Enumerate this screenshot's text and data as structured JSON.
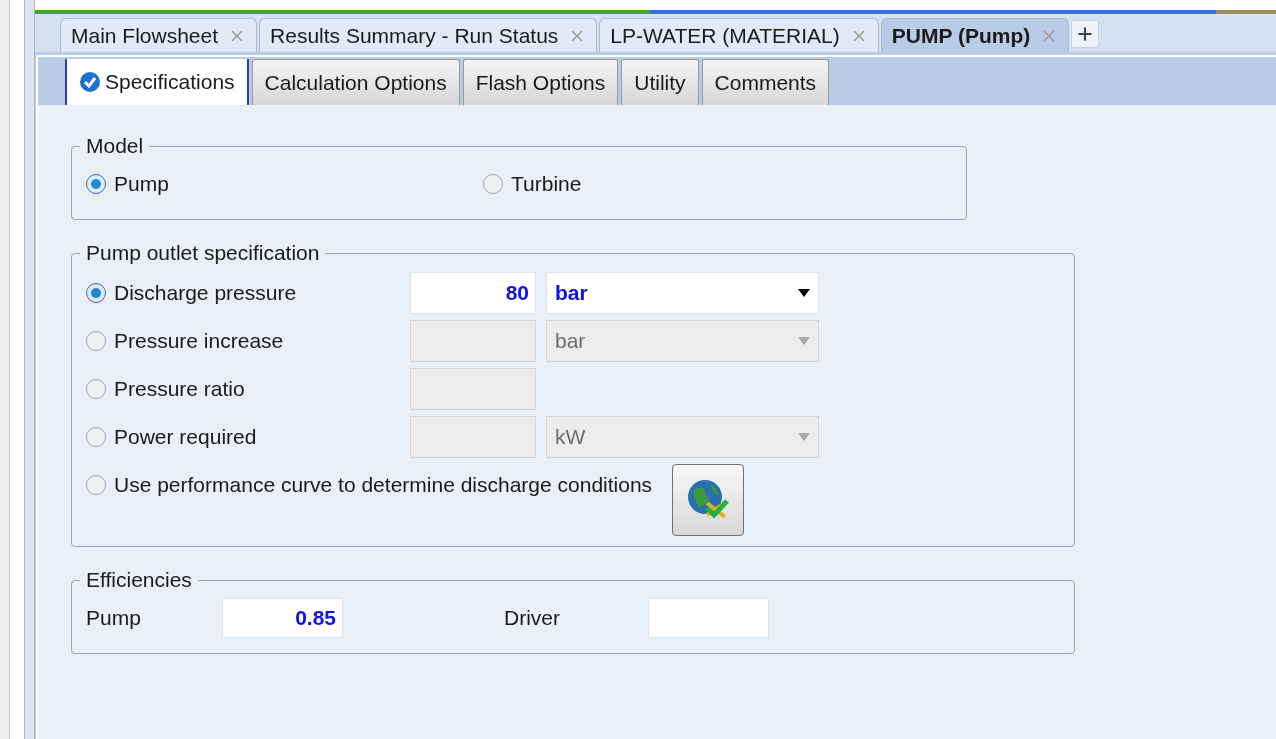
{
  "doc_tabs": [
    {
      "label": "Main Flowsheet",
      "selected": false
    },
    {
      "label": "Results Summary - Run Status",
      "selected": false
    },
    {
      "label": "LP-WATER (MATERIAL)",
      "selected": false
    },
    {
      "label": "PUMP (Pump)",
      "selected": true
    }
  ],
  "sub_tabs": [
    {
      "label": "Specifications",
      "selected": true,
      "complete": true
    },
    {
      "label": "Calculation Options",
      "selected": false,
      "complete": false
    },
    {
      "label": "Flash Options",
      "selected": false,
      "complete": false
    },
    {
      "label": "Utility",
      "selected": false,
      "complete": false
    },
    {
      "label": "Comments",
      "selected": false,
      "complete": false
    }
  ],
  "model": {
    "title": "Model",
    "options": [
      {
        "label": "Pump",
        "selected": true
      },
      {
        "label": "Turbine",
        "selected": false
      }
    ]
  },
  "outlet": {
    "title": "Pump outlet specification",
    "rows": [
      {
        "kind": "value_unit",
        "label": "Discharge pressure",
        "selected": true,
        "value": "80",
        "unit": "bar",
        "disabled": false
      },
      {
        "kind": "value_unit",
        "label": "Pressure increase",
        "selected": false,
        "unit": "bar",
        "disabled": true
      },
      {
        "kind": "value",
        "label": "Pressure ratio",
        "selected": false,
        "disabled": true
      },
      {
        "kind": "value_unit",
        "label": "Power required",
        "selected": false,
        "unit": "kW",
        "disabled": true
      },
      {
        "kind": "curve",
        "label": "Use performance curve to determine discharge conditions",
        "selected": false,
        "disabled": false
      }
    ]
  },
  "efficiencies": {
    "title": "Efficiencies",
    "fields": [
      {
        "label": "Pump",
        "value": "0.85"
      },
      {
        "label": "Driver"
      }
    ]
  }
}
